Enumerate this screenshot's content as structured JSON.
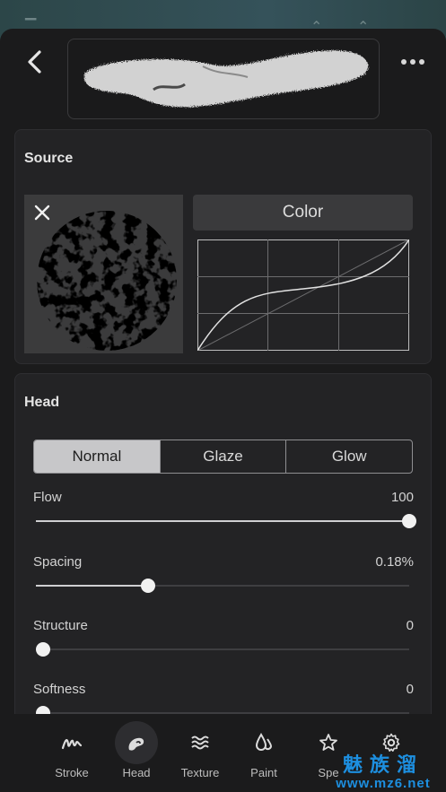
{
  "header": {
    "back_icon": "chevron-left-icon",
    "more_icon": "more-horizontal-icon"
  },
  "source": {
    "title": "Source",
    "color_label": "Color",
    "close_icon": "close-icon"
  },
  "head": {
    "title": "Head",
    "modes": [
      "Normal",
      "Glaze",
      "Glow"
    ],
    "selected_mode": "Normal",
    "sliders": {
      "flow": {
        "label": "Flow",
        "value": "100",
        "level": 1.0
      },
      "spacing": {
        "label": "Spacing",
        "value": "0.18%",
        "level": 0.3
      },
      "structure": {
        "label": "Structure",
        "value": "0",
        "level": 0.0
      },
      "softness": {
        "label": "Softness",
        "value": "0",
        "level": 0.0
      }
    }
  },
  "tabbar": {
    "tabs": [
      {
        "label": "Stroke",
        "icon": "stroke-icon"
      },
      {
        "label": "Head",
        "icon": "brush-head-icon",
        "active": true
      },
      {
        "label": "Texture",
        "icon": "waves-icon"
      },
      {
        "label": "Paint",
        "icon": "drops-icon"
      },
      {
        "label": "Spe",
        "icon": "star-icon"
      },
      {
        "label": "",
        "icon": "gear-icon"
      }
    ]
  },
  "watermark": {
    "cn": "魅族溜",
    "url": "www.mz6.net"
  },
  "colors": {
    "panel": "#1b1b1c",
    "card": "#232325",
    "active_segment": "#c7c7c9",
    "accent_watermark": "#1d8fe0"
  }
}
